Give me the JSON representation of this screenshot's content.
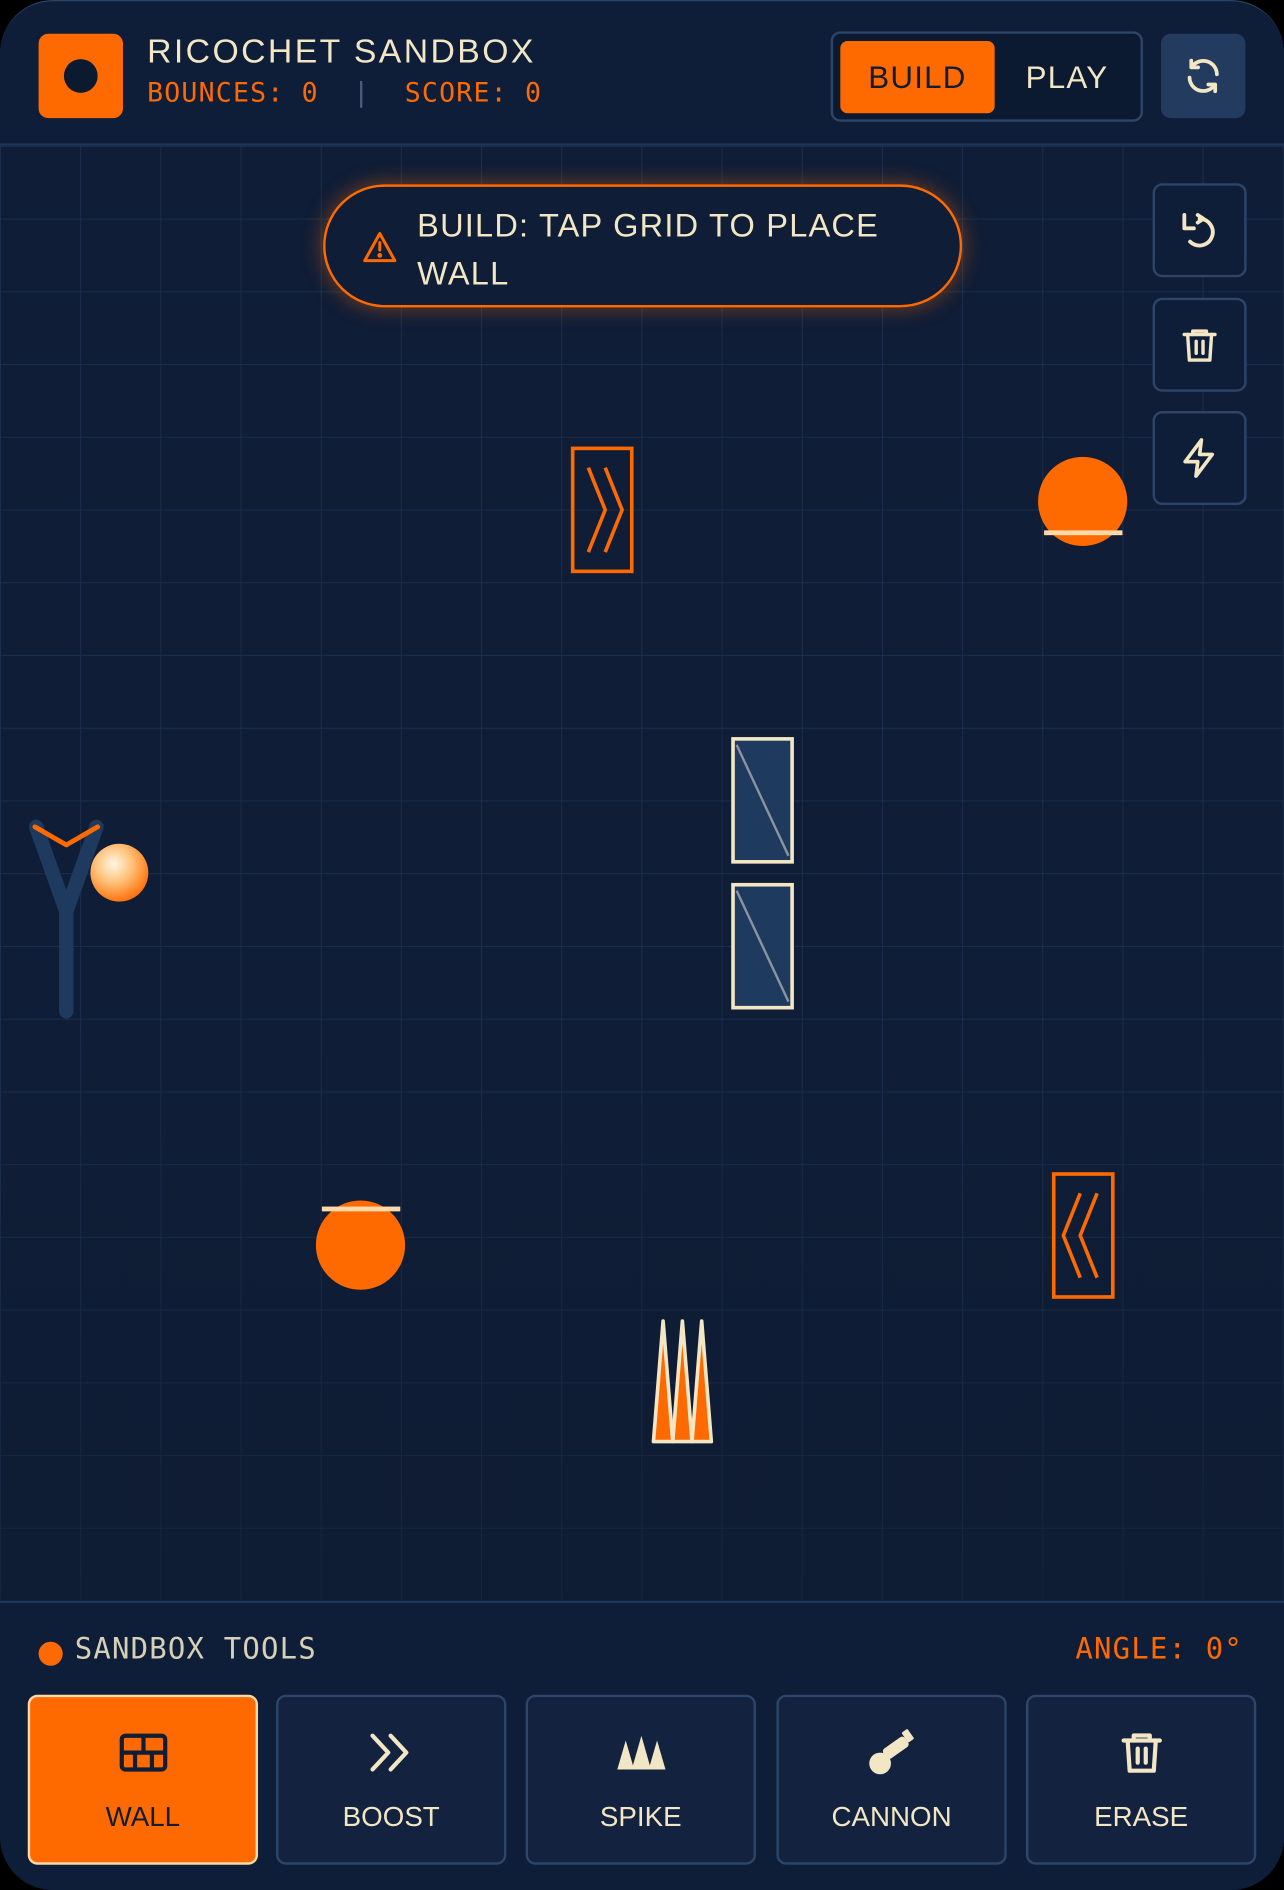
{
  "header": {
    "title": "RICOCHET SANDBOX",
    "bounces_label": "BOUNCES:",
    "bounces_value": "0",
    "separator": "|",
    "score_label": "SCORE:",
    "score_value": "0",
    "mode_build": "BUILD",
    "mode_play": "PLAY",
    "active_mode": "BUILD"
  },
  "banner": {
    "text": "BUILD: TAP GRID TO PLACE WALL",
    "icon": "warning-triangle-icon"
  },
  "side_tools": [
    {
      "name": "rotate",
      "icon": "rotate-icon"
    },
    {
      "name": "delete",
      "icon": "trash-icon"
    },
    {
      "name": "power",
      "icon": "lightning-icon"
    }
  ],
  "toolbar": {
    "title": "SANDBOX TOOLS",
    "angle_label": "ANGLE:",
    "angle_value": "0°",
    "tools": [
      {
        "label": "WALL",
        "icon": "wall-icon",
        "active": true
      },
      {
        "label": "BOOST",
        "icon": "double-chevron-icon",
        "active": false
      },
      {
        "label": "SPIKE",
        "icon": "spike-icon",
        "active": false
      },
      {
        "label": "CANNON",
        "icon": "cannon-icon",
        "active": false
      },
      {
        "label": "ERASE",
        "icon": "trash-icon",
        "active": false
      }
    ]
  },
  "colors": {
    "accent": "#ff6a00",
    "background": "#0f1d36",
    "cream": "#f2e6c4",
    "border": "#2c4568"
  }
}
